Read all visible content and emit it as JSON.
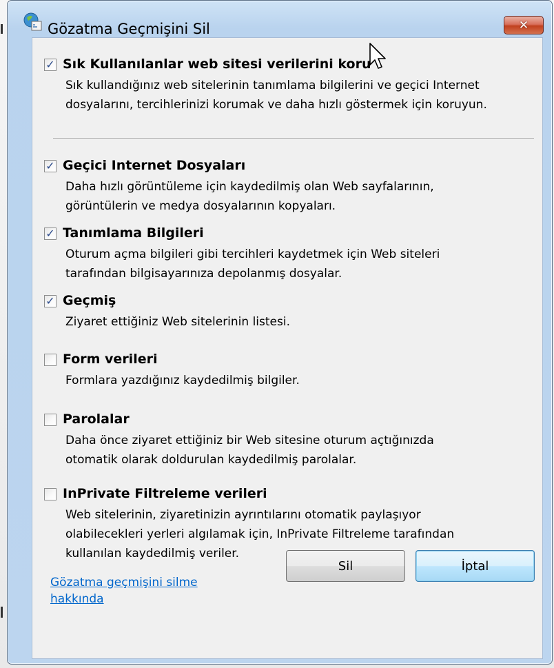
{
  "window": {
    "title": "Gözatma Geçmişini Sil",
    "close_icon": "close-icon"
  },
  "options": [
    {
      "id": "favorites",
      "title": "Sık Kullanılanlar web sitesi verilerini koru",
      "desc_lines": [
        "Sık kullandığınız web sitelerinin tanımlama bilgilerini ve geçici Internet",
        "dosyalarını, tercihlerinizi korumak ve daha hızlı göstermek için koruyun."
      ],
      "checked": true
    },
    {
      "id": "temp-internet-files",
      "title": "Geçici Internet Dosyaları",
      "desc_lines": [
        "Daha hızlı görüntüleme için kaydedilmiş olan Web sayfalarının,",
        "görüntülerin ve medya dosyalarının kopyaları."
      ],
      "checked": true
    },
    {
      "id": "cookies",
      "title": "Tanımlama Bilgileri",
      "desc_lines": [
        "Oturum açma bilgileri gibi tercihleri kaydetmek için Web siteleri",
        "tarafından bilgisayarınıza depolanmış dosyalar."
      ],
      "checked": true
    },
    {
      "id": "history",
      "title": "Geçmiş",
      "desc_lines": [
        "Ziyaret ettiğiniz Web sitelerinin listesi."
      ],
      "checked": true
    },
    {
      "id": "form-data",
      "title": "Form verileri",
      "desc_lines": [
        "Formlara yazdığınız kaydedilmiş bilgiler."
      ],
      "checked": false
    },
    {
      "id": "passwords",
      "title": "Parolalar",
      "desc_lines": [
        "Daha önce ziyaret ettiğiniz bir Web sitesine oturum açtığınızda",
        "otomatik olarak doldurulan kaydedilmiş parolalar."
      ],
      "checked": false
    },
    {
      "id": "inprivate-filtering",
      "title": "InPrivate Filtreleme verileri",
      "desc_lines": [
        "Web sitelerinin, ziyaretinizin ayrıntılarını otomatik paylaşıyor",
        "olabilecekleri yerleri algılamak için, InPrivate Filtreleme tarafından",
        "kullanılan kaydedilmiş veriler."
      ],
      "checked": false
    }
  ],
  "footer": {
    "help_link_lines": [
      "Gözatma geçmişini silme",
      "hakkında"
    ],
    "delete_label": "Sil",
    "cancel_label": "İptal"
  },
  "colors": {
    "link": "#0066cc",
    "close_button": "#c1401f",
    "checkmark": "#2c4b8c"
  }
}
